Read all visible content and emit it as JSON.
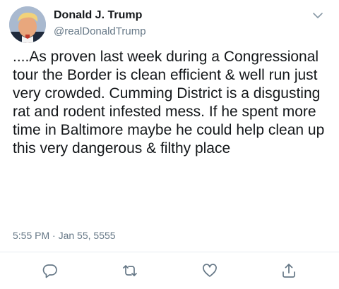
{
  "author": {
    "display_name": "Donald J. Trump",
    "handle": "@realDonaldTrump"
  },
  "tweet": {
    "text": "....As proven last week during a Congressional tour the Border is clean efficient & well run just very crowded. Cumming District is a disgusting rat and rodent infested mess. If he spent more time in Baltimore maybe he could help clean up this very dangerous & filthy place",
    "time": "5:55 PM",
    "separator": "·",
    "date": "Jan 55, 5555"
  },
  "icons": {
    "menu": "chevron-down-icon",
    "reply": "reply-icon",
    "retweet": "retweet-icon",
    "like": "heart-icon",
    "share": "share-icon"
  },
  "colors": {
    "text": "#14171a",
    "secondary": "#657786",
    "divider": "#e6ecf0",
    "icon": "#657786"
  }
}
